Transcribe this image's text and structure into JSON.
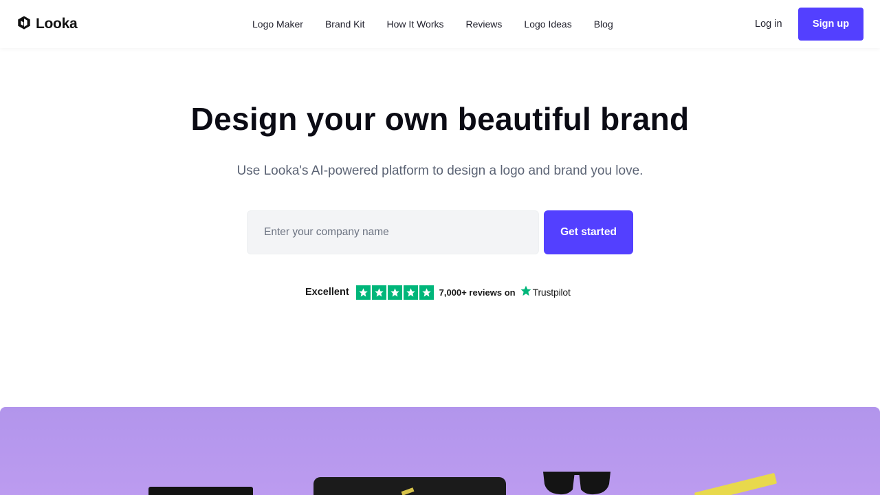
{
  "brand": {
    "name": "Looka",
    "icon": "looka-hexagon-logo-icon"
  },
  "nav": {
    "items": [
      {
        "label": "Logo Maker"
      },
      {
        "label": "Brand Kit"
      },
      {
        "label": "How It Works"
      },
      {
        "label": "Reviews"
      },
      {
        "label": "Logo Ideas"
      },
      {
        "label": "Blog"
      }
    ],
    "login_label": "Log in",
    "signup_label": "Sign up"
  },
  "hero": {
    "title": "Design your own beautiful brand",
    "subtitle": "Use Looka's AI-powered platform to design a logo and brand you love.",
    "input_placeholder": "Enter your company name",
    "input_value": "",
    "cta_label": "Get started"
  },
  "trustpilot": {
    "rating_label": "Excellent",
    "stars": 5,
    "reviews_text": "7,000+ reviews on",
    "brand": "Trustpilot",
    "star_color": "#00b67a"
  },
  "colors": {
    "accent": "#5340ff",
    "banner": "#b89aee"
  }
}
